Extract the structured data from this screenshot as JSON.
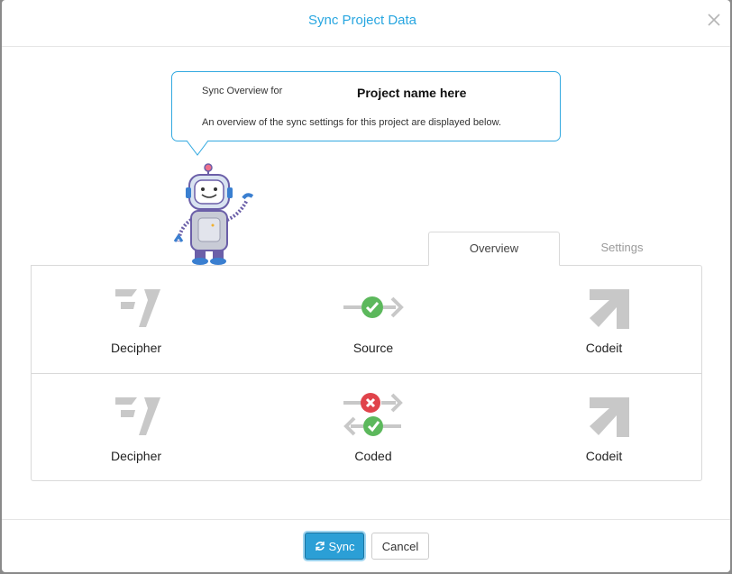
{
  "modal": {
    "title": "Sync Project Data",
    "close_icon": "close-icon"
  },
  "bubble": {
    "label": "Sync Overview for",
    "project_name": "Project name here",
    "description": "An overview of the sync settings for this project are displayed below."
  },
  "tabs": [
    {
      "label": "Overview",
      "active": true
    },
    {
      "label": "Settings",
      "active": false
    }
  ],
  "rows": [
    {
      "left": {
        "label": "Decipher",
        "icon": "decipher-logo-icon"
      },
      "middle": {
        "label": "Source",
        "icon": "sync-one-way-check-icon",
        "status": "ok"
      },
      "right": {
        "label": "Codeit",
        "icon": "codeit-logo-icon"
      }
    },
    {
      "left": {
        "label": "Decipher",
        "icon": "decipher-logo-icon"
      },
      "middle": {
        "label": "Coded",
        "icon": "sync-two-way-mixed-icon",
        "status": "mixed"
      },
      "right": {
        "label": "Codeit",
        "icon": "codeit-logo-icon"
      }
    }
  ],
  "footer": {
    "sync_label": "Sync",
    "cancel_label": "Cancel"
  },
  "colors": {
    "accent": "#28a6e0",
    "primary_button": "#2b9fd6",
    "success": "#5cb85c",
    "error": "#e0434b",
    "muted_icon": "#c8c8c8"
  }
}
